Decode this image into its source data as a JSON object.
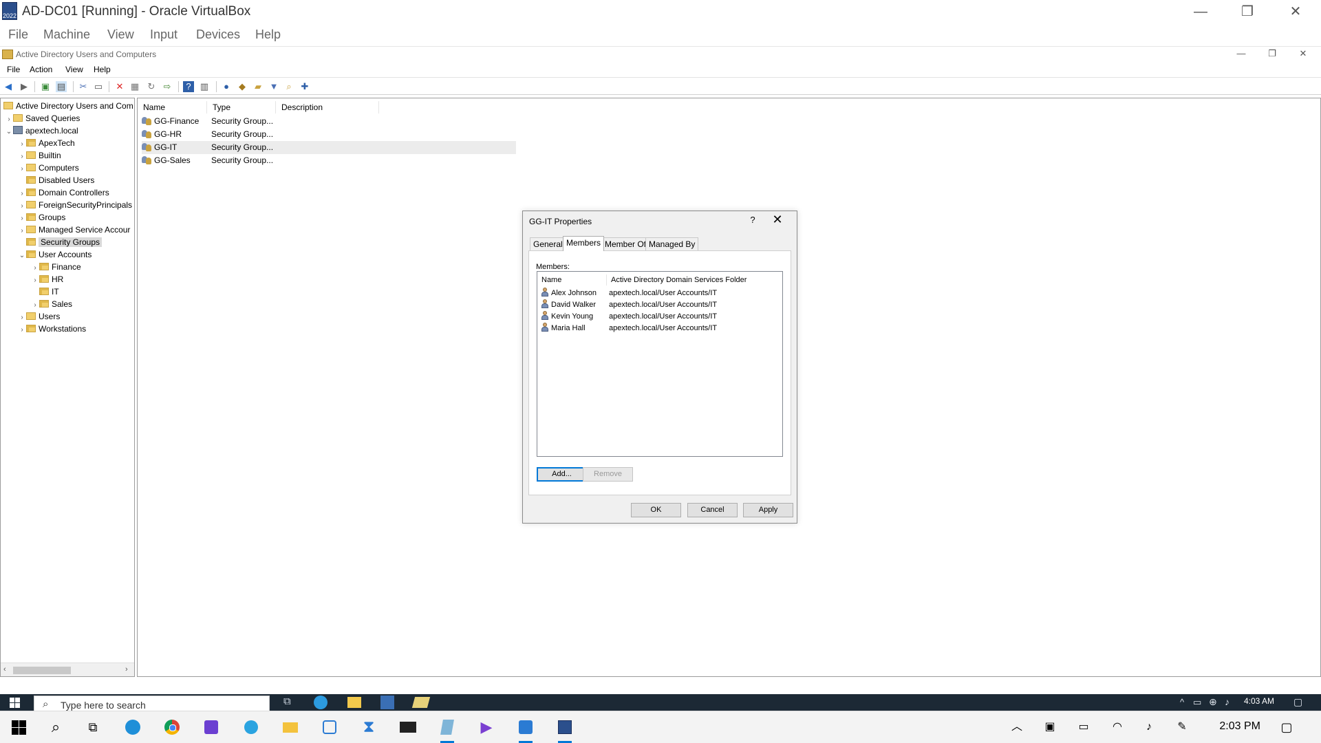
{
  "vbox": {
    "title": "AD-DC01 [Running] - Oracle VirtualBox",
    "icon_badge": "2022",
    "menu": [
      "File",
      "Machine",
      "View",
      "Input",
      "Devices",
      "Help"
    ],
    "controls": {
      "minimize": "—",
      "restore": "❐",
      "close": "✕"
    }
  },
  "mmc": {
    "title": "Active Directory Users and Computers",
    "menu": [
      "File",
      "Action",
      "View",
      "Help"
    ],
    "controls": {
      "minimize": "—",
      "restore": "❐",
      "close": "✕"
    }
  },
  "tree": {
    "root": "Active Directory Users and Com",
    "saved_queries": "Saved Queries",
    "domain": "apextech.local",
    "items": [
      "ApexTech",
      "Builtin",
      "Computers",
      "Disabled Users",
      "Domain Controllers",
      "ForeignSecurityPrincipals",
      "Groups",
      "Managed Service Accour",
      "Security Groups",
      "User Accounts"
    ],
    "user_accounts_children": [
      "Finance",
      "HR",
      "IT",
      "Sales"
    ],
    "after": [
      "Users",
      "Workstations"
    ],
    "selected": "Security Groups"
  },
  "list": {
    "columns": [
      "Name",
      "Type",
      "Description"
    ],
    "rows": [
      {
        "name": "GG-Finance",
        "type": "Security Group...",
        "description": ""
      },
      {
        "name": "GG-HR",
        "type": "Security Group...",
        "description": ""
      },
      {
        "name": "GG-IT",
        "type": "Security Group...",
        "description": ""
      },
      {
        "name": "GG-Sales",
        "type": "Security Group...",
        "description": ""
      }
    ],
    "selected_row": "GG-IT"
  },
  "dialog": {
    "title": "GG-IT Properties",
    "help": "?",
    "close": "✕",
    "tabs": [
      "General",
      "Members",
      "Member Of",
      "Managed By"
    ],
    "active_tab": "Members",
    "members_label": "Members:",
    "columns": [
      "Name",
      "Active Directory Domain Services Folder"
    ],
    "members": [
      {
        "name": "Alex Johnson",
        "folder": "apextech.local/User Accounts/IT"
      },
      {
        "name": "David Walker",
        "folder": "apextech.local/User Accounts/IT"
      },
      {
        "name": "Kevin Young",
        "folder": "apextech.local/User Accounts/IT"
      },
      {
        "name": "Maria Hall",
        "folder": "apextech.local/User Accounts/IT"
      }
    ],
    "add_button": "Add...",
    "remove_button": "Remove",
    "ok_button": "OK",
    "cancel_button": "Cancel",
    "apply_button": "Apply"
  },
  "guest_taskbar": {
    "search_placeholder": "Type here to search",
    "time": "4:03 AM"
  },
  "host_taskbar": {
    "time": "2:03 PM"
  },
  "colors": {
    "accent": "#0078d7",
    "guest_taskbar": "#1c2935",
    "host_taskbar": "#f3f3f3",
    "dialog_bg": "#f0f0f0"
  }
}
